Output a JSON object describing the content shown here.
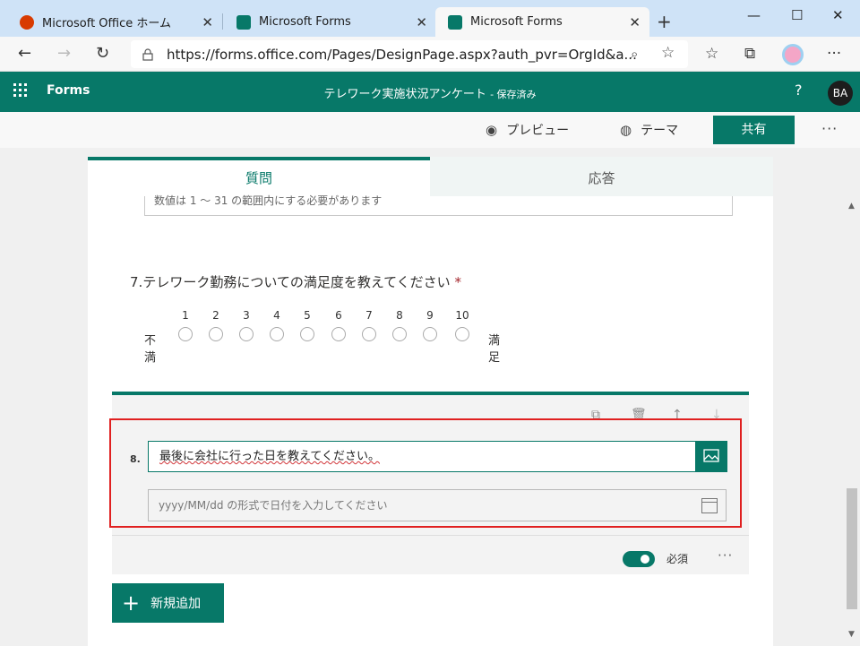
{
  "browser": {
    "tabs": [
      {
        "title": "Microsoft Office ホーム",
        "active": false
      },
      {
        "title": "Microsoft Forms",
        "active": false
      },
      {
        "title": "Microsoft Forms",
        "active": true
      }
    ],
    "close_glyph": "✕",
    "new_tab_glyph": "+",
    "url": "https://forms.office.com/Pages/DesignPage.aspx?auth_pvr=OrgId&a...",
    "window_controls": {
      "minimize": "—",
      "maximize": "☐",
      "close": "✕"
    }
  },
  "app": {
    "name": "Forms",
    "form_title": "テレワーク実施状況アンケート",
    "save_status": "- 保存済み",
    "help": "?",
    "avatar_initials": "BA",
    "accent_color": "#077868"
  },
  "toolbar": {
    "preview_label": "プレビュー",
    "theme_label": "テーマ",
    "share_label": "共有",
    "more_label": "···"
  },
  "form_tabs": {
    "questions_label": "質問",
    "responses_label": "応答"
  },
  "q6": {
    "hint": "数値は 1 ～ 31 の範囲内にする必要があります"
  },
  "q7": {
    "number": "7.",
    "text": "テレワーク勤務についての満足度を教えてください",
    "required_mark": "*",
    "low_label": "不満",
    "high_label": "満足",
    "scale_numbers": [
      "1",
      "2",
      "3",
      "4",
      "5",
      "6",
      "7",
      "8",
      "9",
      "10"
    ]
  },
  "q8": {
    "number": "8.",
    "text": "最後に会社に行った日を教えてください。",
    "date_placeholder": "yyyy/MM/dd の形式で日付を入力してください",
    "required_label": "必須",
    "footer_more": "···"
  },
  "add_new": {
    "label": "新規追加"
  }
}
